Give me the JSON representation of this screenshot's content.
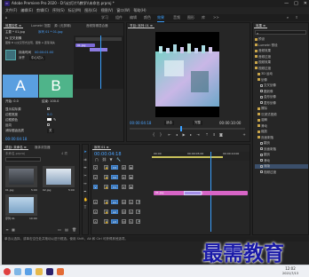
{
  "window": {
    "title": "Adobe Premiere Pro 2020 - D:\\\\幻灯片\\\\教学\\\\未命名.prproj *",
    "app_icon": "Pr",
    "controls": [
      "—",
      "□",
      "✕"
    ]
  },
  "menu": [
    "文件(F)",
    "编辑(E)",
    "剪辑(C)",
    "序列(S)",
    "标记(M)",
    "图形(G)",
    "视图(V)",
    "窗口(W)",
    "帮助(H)"
  ],
  "workspaces": [
    "学习",
    "组件",
    "编辑",
    "颜色",
    "效果",
    "音频",
    "图形",
    "库",
    ">>"
  ],
  "workspace_active": "效果",
  "effect_controls": {
    "tabs": [
      "效果控件 ≡",
      "Lumetri 范围",
      "源: (无剪辑)",
      "音频剪辑混合器"
    ],
    "master_label": "主要 * 01.jpg",
    "seq_label": "序列 01 * 01.jpg",
    "clip_label": "01.jpg",
    "video_header": "视频",
    "fx_title": "fx 交叉划像",
    "fx_desc": "图像 B 以交叉形式出现，图像 A 逐渐消失",
    "duration_label": "持续时间",
    "duration_value": "00:00:01:00",
    "align_label": "对齐",
    "align_value": "中心切入",
    "ab_a": "A",
    "ab_b": "B",
    "start_label": "开始: 0.0",
    "end_label": "结束: 100.0",
    "show_source_label": "显示实际源",
    "border_width_label": "边框宽度",
    "border_width_value": "0.0",
    "border_color_label": "边框颜色",
    "reverse_label": "反向",
    "antialias_label": "消除锯齿品质",
    "antialias_value": "关",
    "timecode": "00:00:04:18"
  },
  "project": {
    "tabs": [
      "项目: 未命名 ≡",
      "媒体浏览器"
    ],
    "path": "未命名.prproj",
    "items_count": "4 项",
    "clips": [
      {
        "name": "01.jpg",
        "duration": "5:00"
      },
      {
        "name": "02.jpg",
        "duration": "5:00"
      },
      {
        "name": "序列 01",
        "duration": "10:00"
      }
    ]
  },
  "program_monitor": {
    "tab": "节目: 序列 01 ≡",
    "timecode_left": "00:00:04:18",
    "fit": "适合",
    "quality": "完整",
    "timecode_right": "00:00:10:00"
  },
  "timeline": {
    "tab": "序列 01 ≡",
    "timecode": "00:00:04:18",
    "ruler_labels": [
      "00:00",
      "00:00:05:00",
      "00:00:10:00"
    ],
    "video_tracks": [
      "V3",
      "V2",
      "V1"
    ],
    "audio_tracks": [
      "A1",
      "A2",
      "A3"
    ],
    "clip_v1_a": "01.jpg",
    "clip_v1_b": "02.jpg",
    "transition_label": "交叉划像"
  },
  "effects_panel": {
    "tab": "效果 ≡",
    "search_placeholder": "",
    "tree": [
      {
        "label": "预设",
        "kind": "folder",
        "indent": 0
      },
      {
        "label": "Lumetri 预设",
        "kind": "folder",
        "indent": 0
      },
      {
        "label": "音频效果",
        "kind": "folder",
        "indent": 0
      },
      {
        "label": "音频过渡",
        "kind": "folder",
        "indent": 0
      },
      {
        "label": "视频效果",
        "kind": "folder",
        "indent": 0
      },
      {
        "label": "视频过渡",
        "kind": "folder",
        "indent": 0
      },
      {
        "label": "3D 运动",
        "kind": "folder",
        "indent": 1
      },
      {
        "label": "划像",
        "kind": "folder",
        "indent": 1
      },
      {
        "label": "交叉划像",
        "kind": "fx",
        "indent": 2
      },
      {
        "label": "圆划像",
        "kind": "fx",
        "indent": 2
      },
      {
        "label": "盒形划像",
        "kind": "fx",
        "indent": 2
      },
      {
        "label": "菱形划像",
        "kind": "fx",
        "indent": 2
      },
      {
        "label": "擦除",
        "kind": "folder",
        "indent": 1
      },
      {
        "label": "沉浸式视频",
        "kind": "folder",
        "indent": 1
      },
      {
        "label": "溶解",
        "kind": "folder",
        "indent": 1
      },
      {
        "label": "滑动",
        "kind": "folder",
        "indent": 1
      },
      {
        "label": "缩放",
        "kind": "folder",
        "indent": 1
      },
      {
        "label": "页面剥落",
        "kind": "folder",
        "indent": 1
      },
      {
        "label": "翻页",
        "kind": "fx",
        "indent": 2
      },
      {
        "label": "页面剥落",
        "kind": "fx",
        "indent": 2
      },
      {
        "label": "翻页",
        "kind": "fx",
        "indent": 2
      },
      {
        "label": "滑动",
        "kind": "fx",
        "indent": 2
      },
      {
        "label": "渐隐",
        "kind": "fx",
        "indent": 2
      },
      {
        "label": "视频过渡",
        "kind": "fx",
        "indent": 2
      }
    ],
    "selected_index": 22
  },
  "status_bar": {
    "text": "单击以选择，或单击空白处并拖动以进行框选。使用 Shift、Alt 和 Ctrl 可获得其他选项。"
  },
  "taskbar": {
    "time": "12:02",
    "date": "2021/7/13"
  },
  "watermark": "最需教育",
  "colors": {
    "accent": "#3aa0ff",
    "clip_pink": "#d765c6",
    "clip_purple": "#7c69d6",
    "ab_green": "#4fb48a",
    "ab_blue": "#5a9fe0"
  }
}
